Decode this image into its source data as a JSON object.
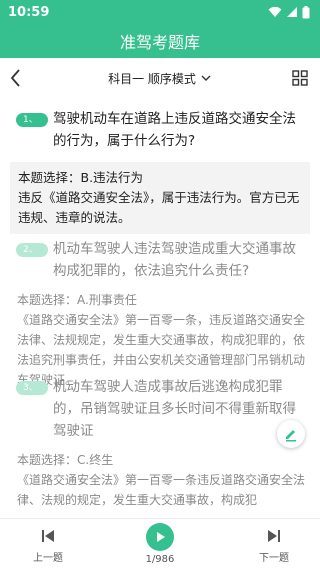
{
  "status_bar": {
    "time": "10:59"
  },
  "app_bar": {
    "title": "准驾考题库"
  },
  "toolbar": {
    "mode_label": "科目一 顺序模式"
  },
  "questions": [
    {
      "number": "1、",
      "text": "驾驶机动车在道路上违反道路交通安全法的行为，属于什么行为?",
      "answer_line1": "本题选择：B.违法行为",
      "answer_line2": "违反《道路交通安全法》，属于违法行为。官方已无违规、违章的说法。"
    },
    {
      "number": "2、",
      "text": "机动车驾驶人违法驾驶造成重大交通事故构成犯罪的，依法追究什么责任?",
      "answer_line1": "本题选择：A.刑事责任",
      "answer_line2": "《道路交通安全法》第一百零一条，违反道路交通安全法律、法规规定，发生重大交通事故，构成犯罪的，依法追究刑事责任，并由公安机关交通管理部门吊销机动车驾驶证。"
    },
    {
      "number": "3、",
      "text": "机动车驾驶人造成事故后逃逸构成犯罪的，吊销驾驶证且多长时间不得重新取得驾驶证",
      "answer_line1": "本题选择：C.终生",
      "answer_line2": "《道路交通安全法》第一百零一条违反道路交通安全法律、法规的规定，发生重大交通事故，构成犯"
    }
  ],
  "bottom_bar": {
    "prev_label": "上一题",
    "next_label": "下一题",
    "counter": "1/986"
  },
  "colors": {
    "accent": "#36c08f",
    "accent_light": "#b5e8d5"
  },
  "icons": [
    "wifi-icon",
    "signal-icon",
    "battery-icon",
    "back-arrow-icon",
    "chevron-down-icon",
    "grid-icon",
    "edit-icon",
    "prev-icon",
    "play-icon",
    "next-icon"
  ]
}
